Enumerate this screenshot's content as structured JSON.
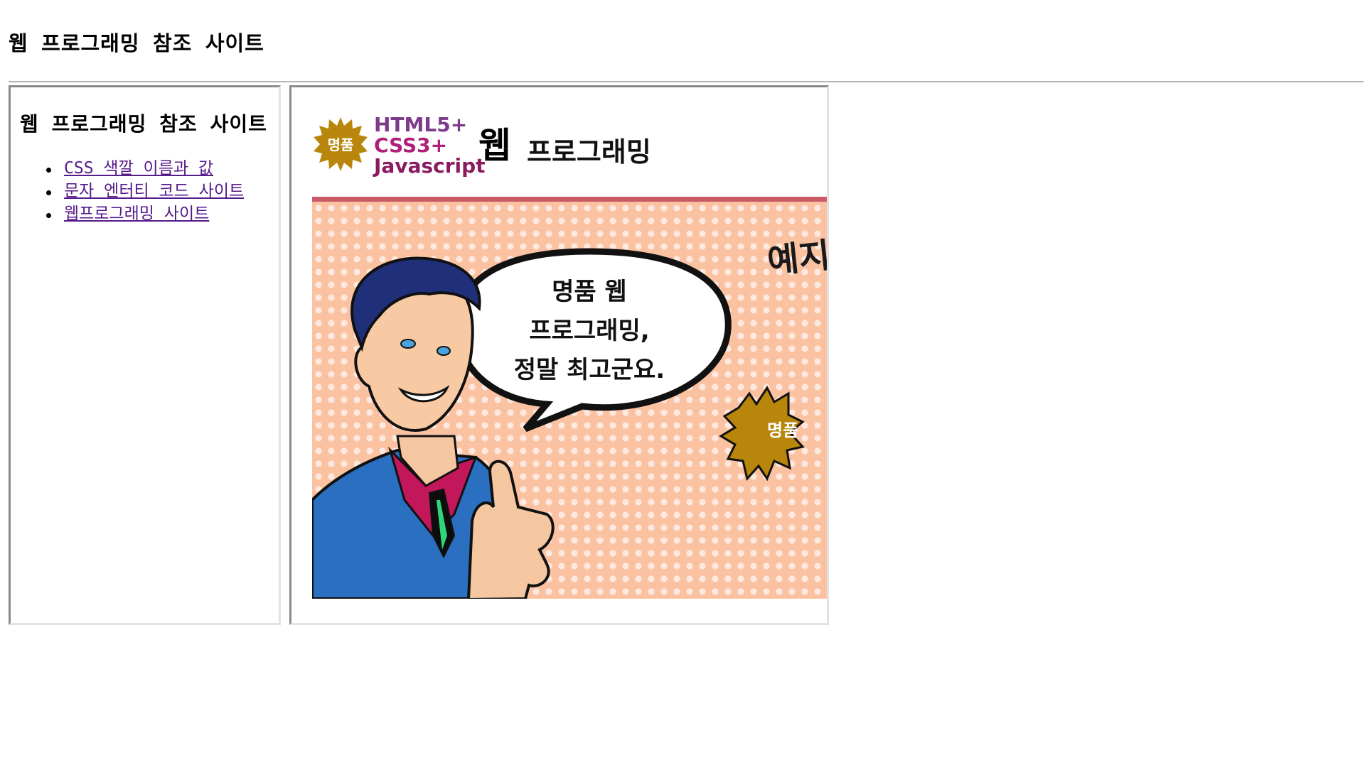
{
  "page": {
    "title": "웹 프로그래밍 참조 사이트"
  },
  "left_frame": {
    "heading": "웹 프로그래밍 참조 사이트",
    "links": [
      {
        "label": "CSS 색깔 이름과 값"
      },
      {
        "label": "문자 엔터티 코드 사이트"
      },
      {
        "label": "웹프로그래밍 사이트"
      }
    ]
  },
  "right_frame": {
    "badge": "명품",
    "stack": [
      "HTML5+",
      "CSS3+",
      "Javascript"
    ],
    "web_word": "웹",
    "programming_word": "프로그래밍",
    "bubble_lines": [
      "명품 웹",
      "프로그래밍,",
      "정말 최고군요."
    ],
    "side_partial": "예지",
    "side_badge_partial": "명품"
  },
  "colors": {
    "link": "#551a8b",
    "rule": "#b5b5b5",
    "banner_bar": "#c95a66",
    "comic_bg": "#fbc2a2",
    "badge_gold": "#b8860b"
  }
}
